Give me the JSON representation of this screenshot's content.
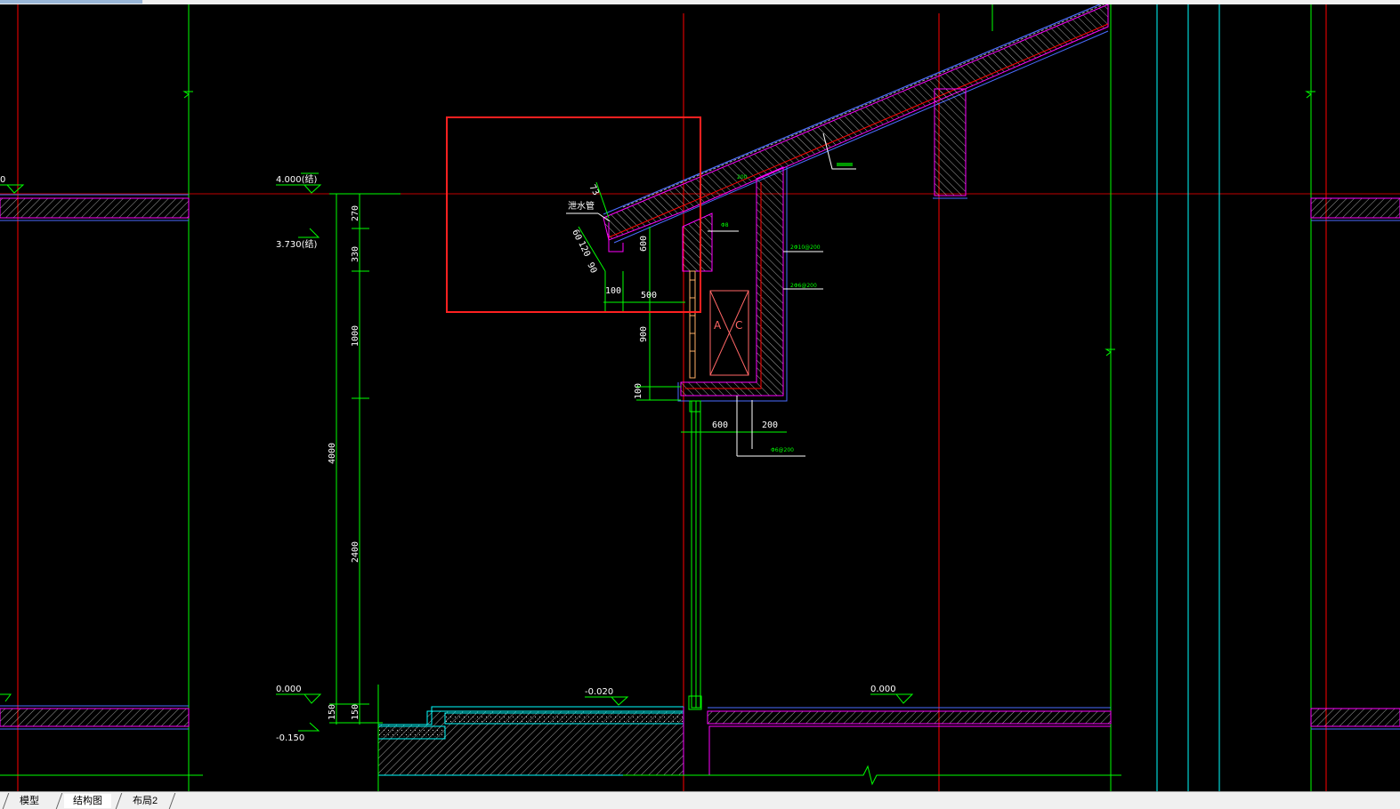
{
  "layout_tabs": [
    {
      "label": "模型",
      "active": false
    },
    {
      "label": "结构图",
      "active": true
    },
    {
      "label": "布局2",
      "active": false
    }
  ],
  "levels": {
    "left_top_partial": "0",
    "roof_level": "4.000(结)",
    "beam_level": "3.730(结)",
    "floor_left": "0.000",
    "floor_left_sub": "-0.150",
    "ground_outside": "-0.020",
    "floor_right": "0.000"
  },
  "vertical_dims": [
    "270",
    "330",
    "1000",
    "4000",
    "2400",
    "150",
    "150"
  ],
  "detail_dims": {
    "d73": "73",
    "d60": "60",
    "d120": "120",
    "d90": "90",
    "d600v": "600",
    "d100a": "100",
    "d500": "500",
    "d900": "900",
    "d100b": "100",
    "d600h": "600",
    "d200": "200"
  },
  "annotations": {
    "drain_pipe": "泄水管",
    "tiny_1": "200",
    "tiny_2": "Φ8",
    "tiny_3": "2Φ10@200",
    "tiny_4": "2Φ6@200",
    "tiny_5": "Φ6@200"
  },
  "ac_label": [
    "A",
    "C"
  ],
  "colors": {
    "background": "#000000",
    "axis_red": "#ff0000",
    "structure_magenta": "#ff00ff",
    "outline_blue": "#4a6cff",
    "dim_green": "#00ff00",
    "grid_cyan": "#00ffff",
    "selection_box": "#ff2020"
  }
}
